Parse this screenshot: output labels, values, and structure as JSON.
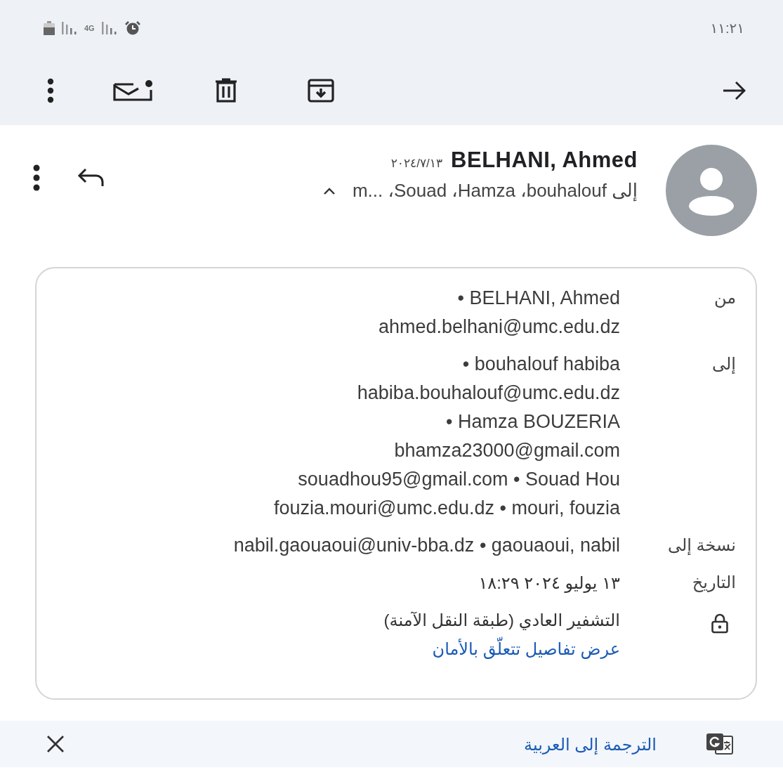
{
  "status_bar": {
    "network": "4G",
    "time": "١١:٢١"
  },
  "header": {
    "date": "٢٠٢٤/٧/١٣",
    "sender": "BELHANI, Ahmed",
    "recipients_prefix": "إلى",
    "recipients": [
      "bouhalouf",
      "Hamza",
      "Souad",
      "m..."
    ],
    "separator": "،",
    "expanded": true
  },
  "details": [
    {
      "kind": "contacts",
      "label": "من",
      "lines": [
        "• BELHANI, Ahmed",
        "ahmed.belhani@umc.edu.dz"
      ]
    },
    {
      "kind": "contacts",
      "label": "إلى",
      "lines": [
        "• bouhalouf habiba",
        "habiba.bouhalouf@umc.edu.dz",
        "• Hamza BOUZERIA",
        "bhamza23000@gmail.com",
        "souadhou95@gmail.com • Souad Hou",
        "fouzia.mouri@umc.edu.dz • mouri, fouzia"
      ]
    },
    {
      "kind": "contacts",
      "label": "نسخة إلى",
      "lines": [
        "nabil.gaouaoui@univ-bba.dz • gaouaoui, nabil"
      ]
    },
    {
      "kind": "text",
      "label": "التاريخ",
      "text": "١٣ يوليو ٢٠٢٤ ١٨:٢٩"
    },
    {
      "kind": "security",
      "text": "التشفير العادي (طبقة النقل الآمنة)",
      "link": "عرض تفاصيل تتعلّق بالأمان"
    }
  ],
  "translate_bar": {
    "link": "الترجمة إلى العربية"
  }
}
